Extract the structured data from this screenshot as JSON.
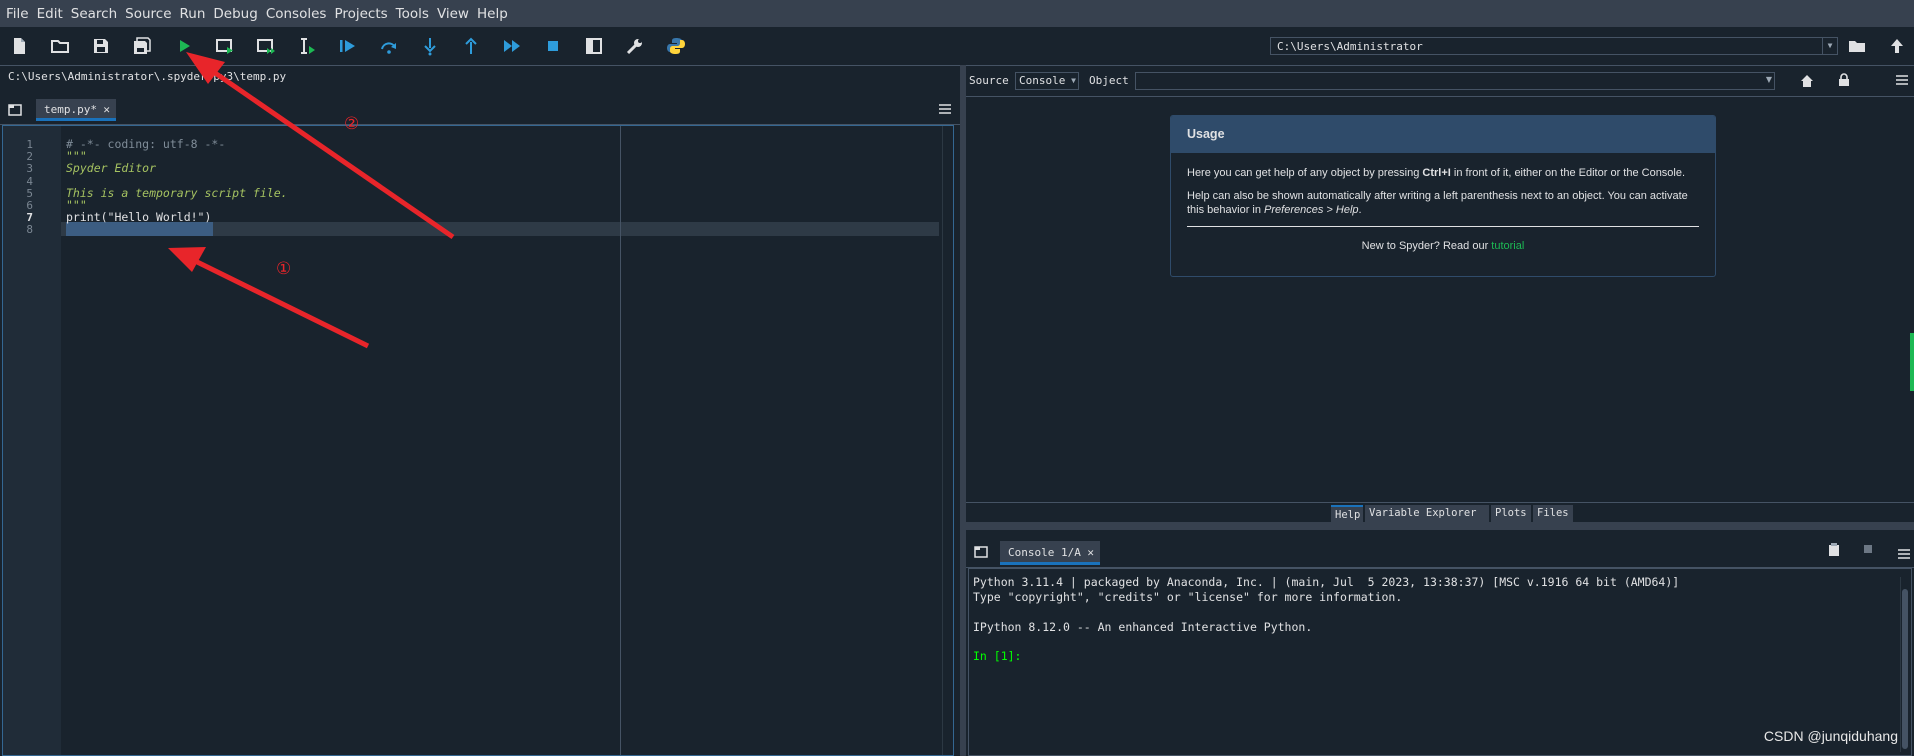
{
  "menu": [
    "File",
    "Edit",
    "Search",
    "Source",
    "Run",
    "Debug",
    "Consoles",
    "Projects",
    "Tools",
    "View",
    "Help"
  ],
  "toolbar": {
    "icons": [
      "new-file-icon",
      "open-folder-icon",
      "save-icon",
      "save-all-icon",
      "run-file-icon",
      "run-cell-icon",
      "run-cell-advance-icon",
      "run-selection-icon",
      "debug-file-icon",
      "step-over-icon",
      "step-into-icon",
      "step-return-icon",
      "continue-icon",
      "stop-debug-icon",
      "maximize-pane-icon",
      "preferences-wrench-icon",
      "python-path-icon"
    ],
    "working_directory": "C:\\Users\\Administrator"
  },
  "editor": {
    "path": "C:\\Users\\Administrator\\.spyder-py3\\temp.py",
    "tab_label": "temp.py*",
    "lines": [
      {
        "n": "1",
        "text": "# -*- coding: utf-8 -*-",
        "color": "#7f8c98",
        "italic": false
      },
      {
        "n": "2",
        "text": "\"\"\"",
        "color": "#a5c261",
        "italic": true
      },
      {
        "n": "3",
        "text": "Spyder Editor",
        "color": "#a5c261",
        "italic": true
      },
      {
        "n": "4",
        "text": "",
        "color": "#e0e1e3",
        "italic": false
      },
      {
        "n": "5",
        "text": "This is a temporary script file.",
        "color": "#a5c261",
        "italic": true
      },
      {
        "n": "6",
        "text": "\"\"\"",
        "color": "#a5c261",
        "italic": true
      },
      {
        "n": "7",
        "text": "print(\"Hello World!\")",
        "color": "#e0e1e3",
        "italic": false
      },
      {
        "n": "8",
        "text": "",
        "color": "#e0e1e3",
        "italic": false
      }
    ]
  },
  "help": {
    "source_label": "Source",
    "source_value": "Console",
    "object_label": "Object",
    "object_value": "",
    "usage_title": "Usage",
    "p1_a": "Here you can get help of any object by pressing ",
    "p1_b": "Ctrl+I",
    "p1_c": " in front of it, either on the Editor or the Console.",
    "p2_a": "Help can also be shown automatically after writing a left parenthesis next to an object. You can activate this behavior in ",
    "p2_b": "Preferences > Help",
    "p2_c": ".",
    "footer_a": "New to Spyder? Read our ",
    "footer_link": "tutorial",
    "tabs": [
      "Help",
      "Variable Explorer",
      "Plots",
      "Files"
    ]
  },
  "console": {
    "tab_label": "Console 1/A",
    "lines": [
      "Python 3.11.4 | packaged by Anaconda, Inc. | (main, Jul  5 2023, 13:38:37) [MSC v.1916 64 bit (AMD64)]",
      "Type \"copyright\", \"credits\" or \"license\" for more information.",
      "",
      "IPython 8.12.0 -- An enhanced Interactive Python.",
      ""
    ],
    "prompt": "In [1]:"
  },
  "annotations": {
    "one": "①",
    "two": "②"
  },
  "watermark": "CSDN @junqiduhang",
  "colors": {
    "accent": "#1a72bb",
    "arrow": "#e8252a",
    "prompt": "#00ff00",
    "run": "#1db954",
    "debug": "#2e9cdb"
  }
}
